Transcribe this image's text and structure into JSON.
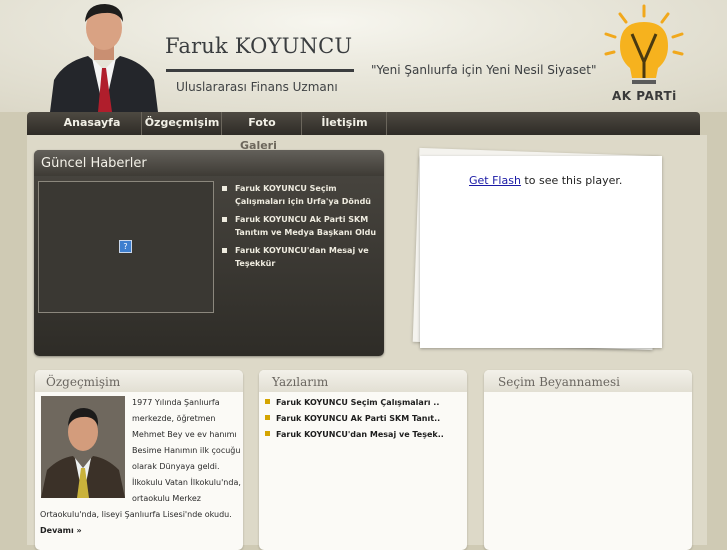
{
  "header": {
    "name": "Faruk KOYUNCU",
    "subtitle": "Uluslararası Finans Uzmanı",
    "slogan": "\"Yeni Şanlıurfa için Yeni Nesil Siyaset\"",
    "party": "AK PARTi"
  },
  "nav": {
    "items": [
      "Anasayfa",
      "Özgeçmişim",
      "Foto",
      "İletişim"
    ],
    "overflow_text": "Galeri"
  },
  "news": {
    "title": "Güncel Haberler",
    "image_placeholder": "?",
    "items": [
      "Faruk KOYUNCU Seçim Çalışmaları için Urfa'ya Döndü",
      "Faruk KOYUNCU Ak Parti SKM Tanıtım ve Medya Başkanı Oldu",
      "Faruk KOYUNCU'dan Mesaj ve Teşekkür"
    ]
  },
  "flash": {
    "link_text": "Get Flash",
    "suffix": " to see this player."
  },
  "bio": {
    "title": "Özgeçmişim",
    "lines": [
      "1977 Yılında Şanlıurfa",
      "merkezde, öğretmen",
      "Mehmet Bey ve ev hanımı",
      "Besime Hanımın ilk çocuğu",
      "olarak Dünyaya geldi.",
      "İlkokulu Vatan İlkokulu'nda,",
      "ortaokulu Merkez",
      "Ortaokulu'nda, liseyi Şanlıurfa Lisesi'nde okudu."
    ],
    "more": "Devamı »"
  },
  "posts": {
    "title": "Yazılarım",
    "items": [
      "Faruk KOYUNCU Seçim Çalışmaları ..",
      "Faruk KOYUNCU Ak Parti SKM Tanıt..",
      "Faruk KOYUNCU'dan Mesaj ve Teşek.."
    ]
  },
  "manifesto": {
    "title": "Seçim Beyannamesi"
  },
  "colors": {
    "nav_bg": "#3a3731",
    "accent_bullet": "#d4a400",
    "link": "#1a1aa6"
  }
}
